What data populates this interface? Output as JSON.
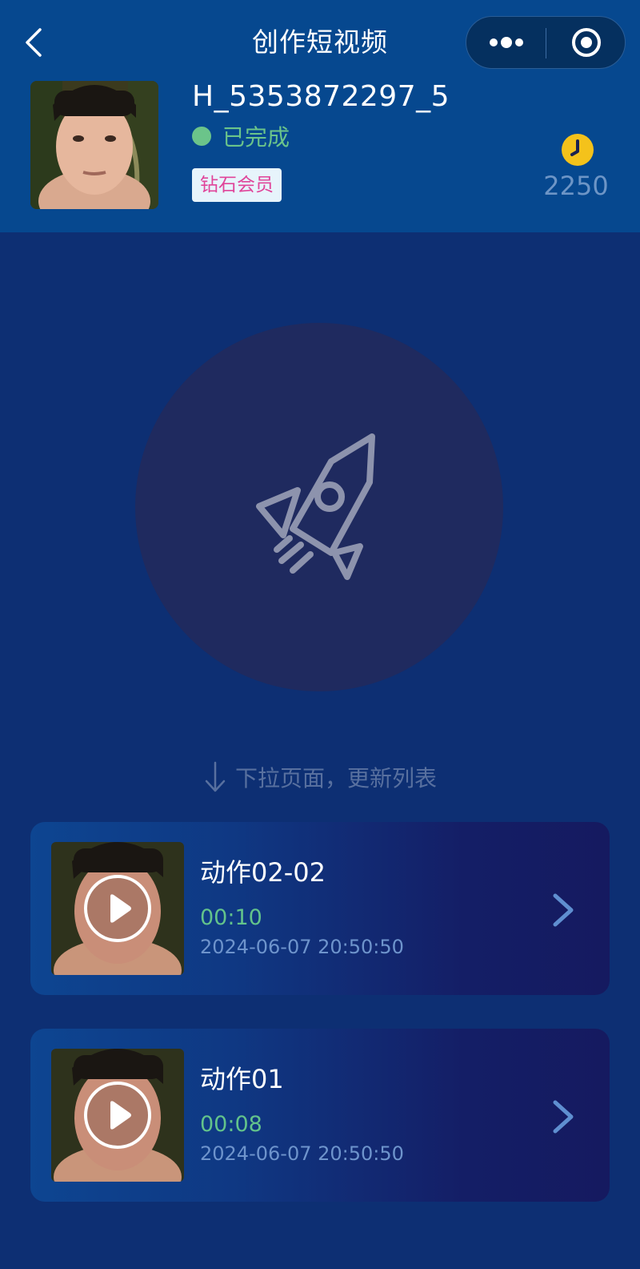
{
  "nav": {
    "title": "创作短视频",
    "back_icon": "chevron-left-icon",
    "more_icon": "more-dots-icon",
    "close_icon": "target-close-icon"
  },
  "profile": {
    "username": "H_5353872297_5",
    "status": "已完成",
    "status_color": "#6bc48a",
    "membership": "钻石会员",
    "points": "2250",
    "points_icon": "clock-icon"
  },
  "main": {
    "center_icon": "rocket-icon",
    "pull_hint": "下拉页面，更新列表"
  },
  "videos": [
    {
      "title": "动作02-02",
      "duration": "00:10",
      "date": "2024-06-07 20:50:50"
    },
    {
      "title": "动作01",
      "duration": "00:08",
      "date": "2024-06-07 20:50:50"
    }
  ],
  "colors": {
    "header_bg": "#06488f",
    "page_bg": "#0d2f73",
    "accent_green": "#6bc48a",
    "badge_text": "#e0459a"
  }
}
